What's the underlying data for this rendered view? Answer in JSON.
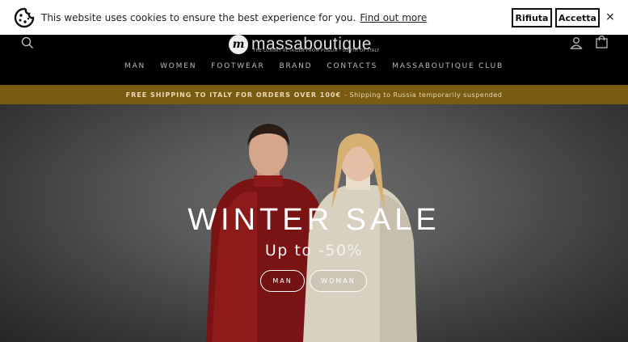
{
  "cookie_banner": {
    "message": "This website uses cookies to ensure the best experience for you.",
    "link_text": "Find out more",
    "reject_label": "Rifiuta",
    "accept_label": "Accetta",
    "close_glyph": "×",
    "icon": "cookie-icon"
  },
  "header": {
    "logo_text": "massaboutique",
    "logo_mark": "m",
    "tagline": "THE LUXURY RETAILER FROM PUGLIA · SOUTH OF ITALY",
    "icons": [
      "search-icon",
      "account-icon",
      "cart-icon"
    ],
    "nav": [
      {
        "label": "MAN"
      },
      {
        "label": "WOMEN"
      },
      {
        "label": "FOOTWEAR"
      },
      {
        "label": "BRAND"
      },
      {
        "label": "CONTACTS"
      },
      {
        "label": "MASSABOUTIQUE CLUB"
      }
    ]
  },
  "shipping_banner": {
    "bold_text": "FREE SHIPPING TO ITALY FOR ORDERS OVER 100€",
    "rest_text": "- Shipping to Russia temporarily suspended",
    "color": "#7a5b14"
  },
  "hero": {
    "title": "WINTER SALE",
    "subtitle": "Up to -50%",
    "buttons": [
      {
        "label": "MAN"
      },
      {
        "label": "WOMAN"
      }
    ]
  }
}
